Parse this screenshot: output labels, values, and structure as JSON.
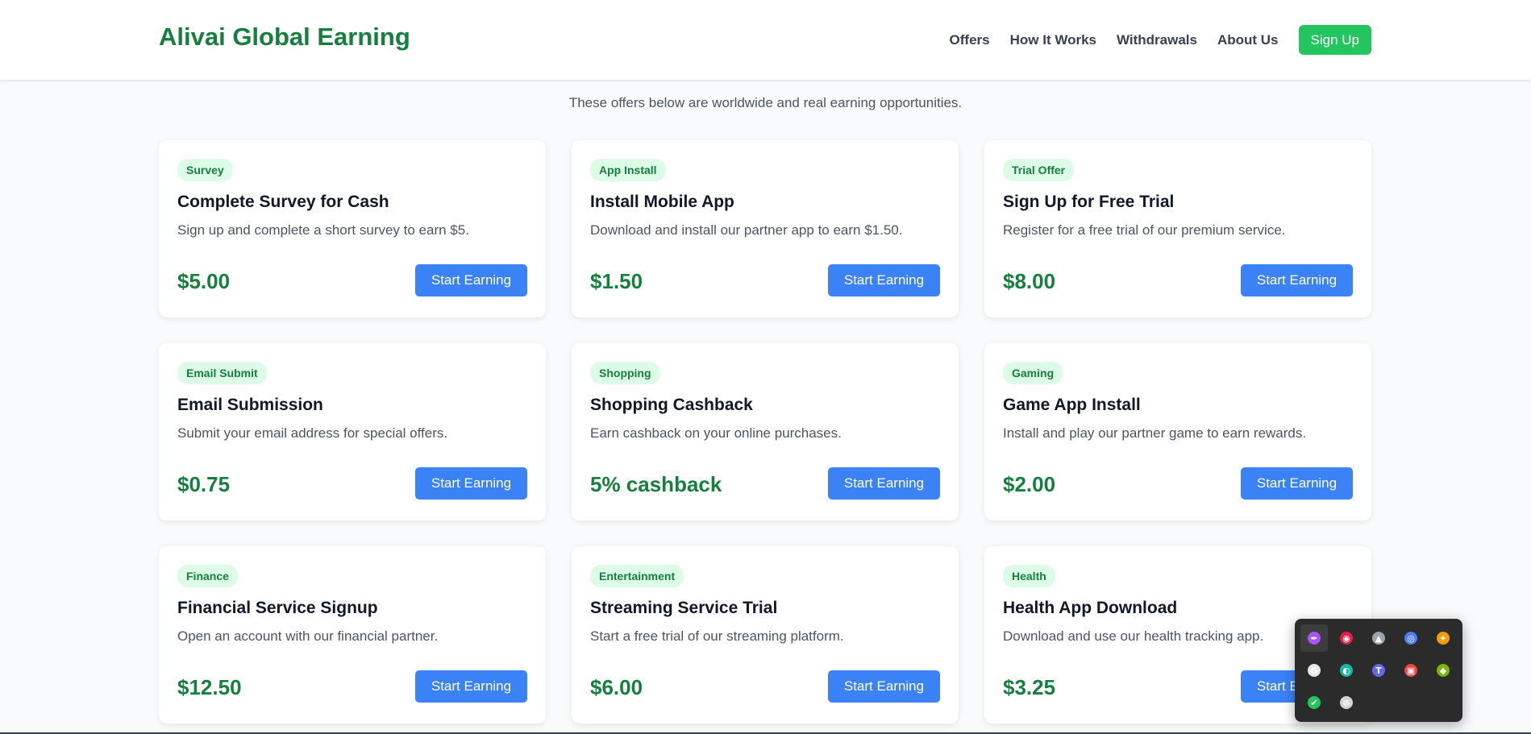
{
  "header": {
    "brand": "Alivai Global Earning",
    "nav": [
      "Offers",
      "How It Works",
      "Withdrawals",
      "About Us"
    ],
    "signup_label": "Sign Up"
  },
  "intro": "These offers below are worldwide and real earning opportunities.",
  "offers": [
    {
      "badge": "Survey",
      "title": "Complete Survey for Cash",
      "desc": "Sign up and complete a short survey to earn $5.",
      "amount": "$5.00",
      "button": "Start Earning"
    },
    {
      "badge": "App Install",
      "title": "Install Mobile App",
      "desc": "Download and install our partner app to earn $1.50.",
      "amount": "$1.50",
      "button": "Start Earning"
    },
    {
      "badge": "Trial Offer",
      "title": "Sign Up for Free Trial",
      "desc": "Register for a free trial of our premium service.",
      "amount": "$8.00",
      "button": "Start Earning"
    },
    {
      "badge": "Email Submit",
      "title": "Email Submission",
      "desc": "Submit your email address for special offers.",
      "amount": "$0.75",
      "button": "Start Earning"
    },
    {
      "badge": "Shopping",
      "title": "Shopping Cashback",
      "desc": "Earn cashback on your online purchases.",
      "amount": "5% cashback",
      "button": "Start Earning"
    },
    {
      "badge": "Gaming",
      "title": "Game App Install",
      "desc": "Install and play our partner game to earn rewards.",
      "amount": "$2.00",
      "button": "Start Earning"
    },
    {
      "badge": "Finance",
      "title": "Financial Service Signup",
      "desc": "Open an account with our financial partner.",
      "amount": "$12.50",
      "button": "Start Earning"
    },
    {
      "badge": "Entertainment",
      "title": "Streaming Service Trial",
      "desc": "Start a free trial of our streaming platform.",
      "amount": "$6.00",
      "button": "Start Earning"
    },
    {
      "badge": "Health",
      "title": "Health App Download",
      "desc": "Download and use our health tracking app.",
      "amount": "$3.25",
      "button": "Start Earning"
    }
  ],
  "colors": {
    "brand_green": "#15803d",
    "signup_green": "#22c55e",
    "button_blue": "#3b82f6",
    "badge_bg": "#dcfce7"
  },
  "tray": {
    "icons": [
      {
        "name": "feather-icon",
        "color": "#a855f7"
      },
      {
        "name": "camera-app-icon",
        "color": "#e11d48"
      },
      {
        "name": "drive-icon",
        "color": "#9ca3af"
      },
      {
        "name": "browser-circle-icon",
        "color": "#4f7cf7"
      },
      {
        "name": "copilot-icon",
        "color": "#f59e0b"
      },
      {
        "name": "grammarly-icon",
        "color": "#e5e7eb"
      },
      {
        "name": "edge-icon",
        "color": "#14b8a6"
      },
      {
        "name": "teams-icon",
        "color": "#6366f1"
      },
      {
        "name": "photos-icon",
        "color": "#ef4444"
      },
      {
        "name": "nvidia-icon",
        "color": "#76b900"
      },
      {
        "name": "defender-icon",
        "color": "#22c55e"
      },
      {
        "name": "camera-off-icon",
        "color": "#d1d5db"
      }
    ]
  }
}
